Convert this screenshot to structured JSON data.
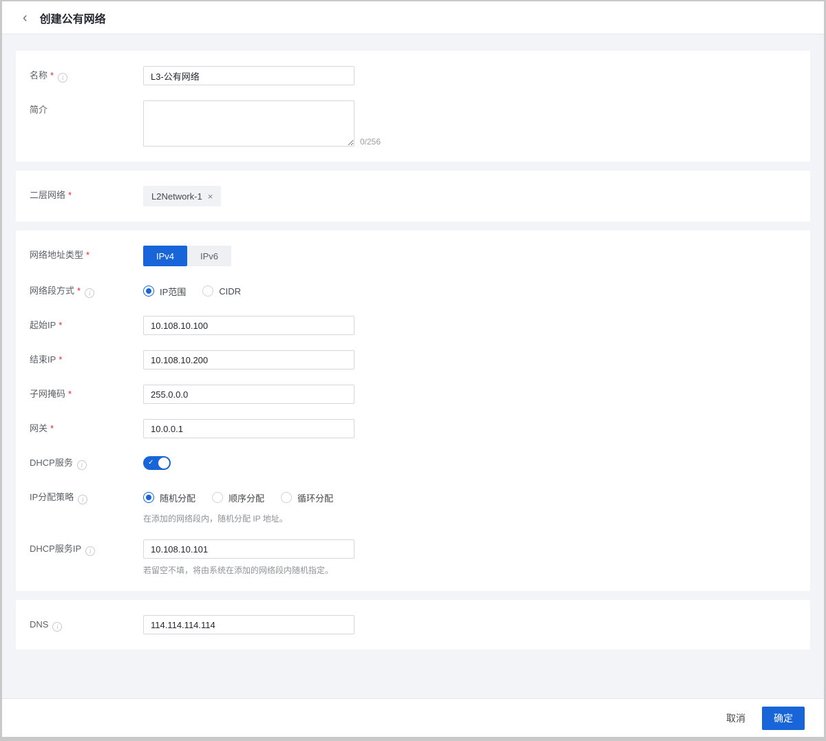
{
  "header": {
    "title": "创建公有网络"
  },
  "marks": {
    "back": "‹",
    "required": "*",
    "info": "i",
    "close": "×",
    "check": "✓"
  },
  "colors": {
    "primary": "#1765d8",
    "required": "#f5222d"
  },
  "form": {
    "name": {
      "label": "名称",
      "value": "L3-公有网络"
    },
    "description": {
      "label": "简介",
      "value": "",
      "counter": "0/256"
    },
    "l2network": {
      "label": "二层网络",
      "tag": "L2Network-1"
    },
    "ip_version": {
      "label": "网络地址类型",
      "options": [
        "IPv4",
        "IPv6"
      ],
      "selected": "IPv4"
    },
    "segment_method": {
      "label": "网络段方式",
      "options": [
        "IP范围",
        "CIDR"
      ],
      "selected": "IP范围"
    },
    "start_ip": {
      "label": "起始IP",
      "value": "10.108.10.100"
    },
    "end_ip": {
      "label": "结束IP",
      "value": "10.108.10.200"
    },
    "netmask": {
      "label": "子网掩码",
      "value": "255.0.0.0"
    },
    "gateway": {
      "label": "网关",
      "value": "10.0.0.1"
    },
    "dhcp": {
      "label": "DHCP服务",
      "enabled": true
    },
    "alloc_strategy": {
      "label": "IP分配策略",
      "options": [
        "随机分配",
        "顺序分配",
        "循环分配"
      ],
      "selected": "随机分配",
      "helper": "在添加的网络段内，随机分配 IP 地址。"
    },
    "dhcp_ip": {
      "label": "DHCP服务IP",
      "value": "10.108.10.101",
      "helper": "若留空不填，将由系统在添加的网络段内随机指定。"
    },
    "dns": {
      "label": "DNS",
      "value": "114.114.114.114"
    }
  },
  "footer": {
    "cancel": "取消",
    "confirm": "确定"
  }
}
